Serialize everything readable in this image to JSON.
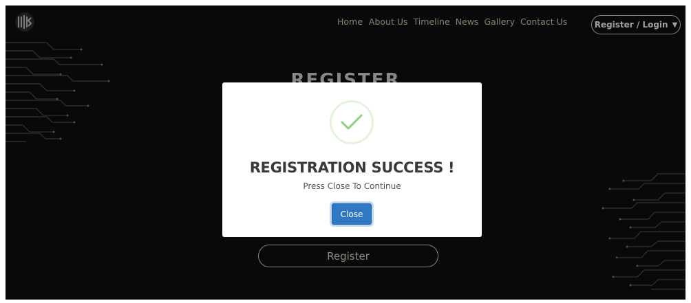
{
  "nav": {
    "links": [
      "Home",
      "About Us",
      "Timeline",
      "News",
      "Gallery",
      "Contact Us"
    ],
    "register_login_label": "Register / Login",
    "caret": "▼"
  },
  "page": {
    "title": "REGISTER",
    "register_button_label": "Register"
  },
  "modal": {
    "title": "REGISTRATION SUCCESS !",
    "message": "Press Close To Continue",
    "close_label": "Close"
  },
  "colors": {
    "background": "#0e0e0e",
    "nav_text": "#cfc9a8",
    "success_check": "#8fd07a",
    "close_button": "#2f78c4"
  },
  "icons": {
    "logo": "logo-icon",
    "success": "check-circle-icon",
    "caret": "caret-down-icon"
  }
}
